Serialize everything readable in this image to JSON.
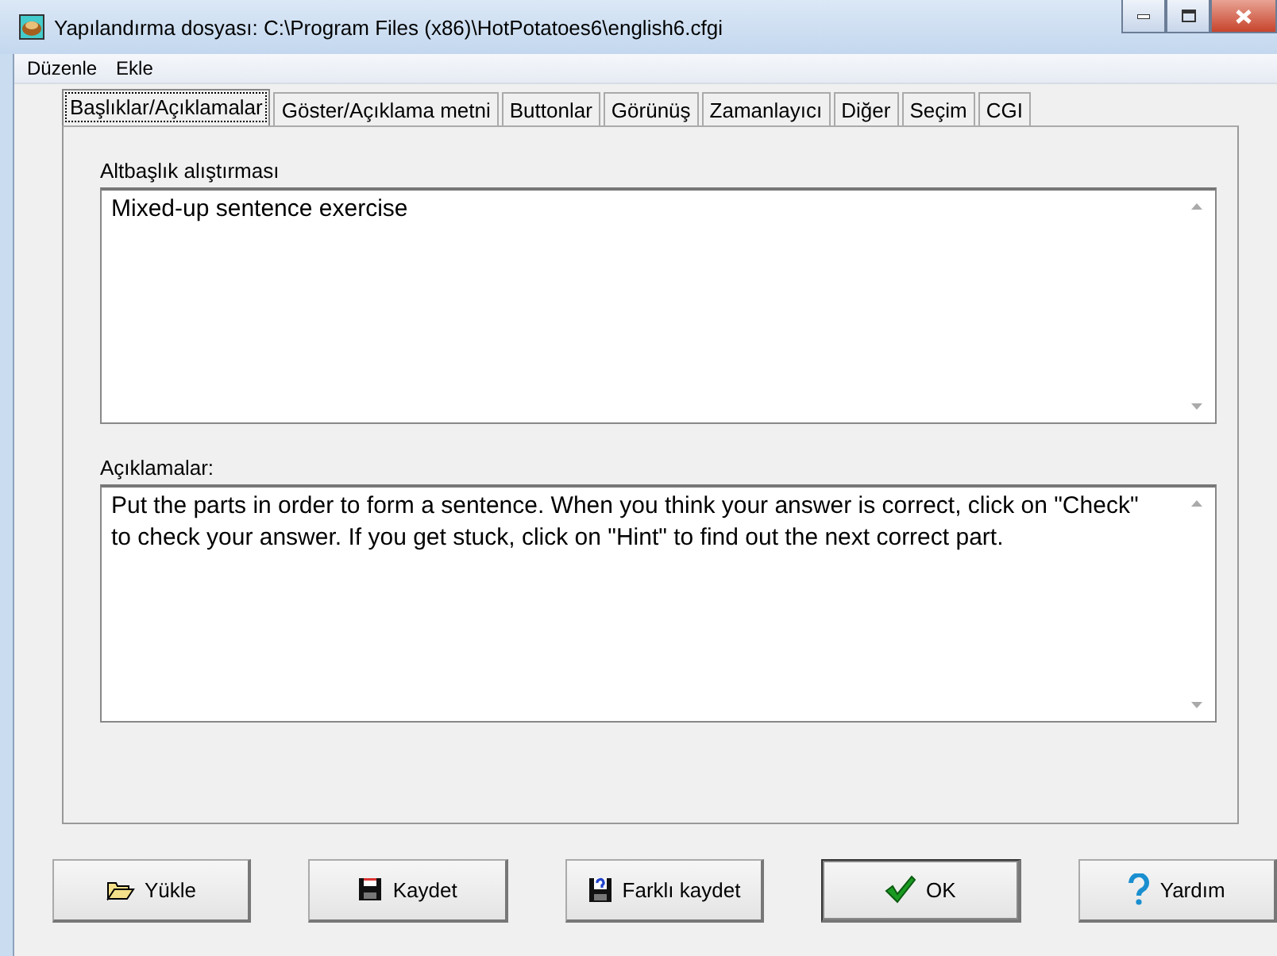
{
  "window": {
    "title": "Yapılandırma dosyası: C:\\Program Files (x86)\\HotPotatoes6\\english6.cfgi"
  },
  "menu": [
    "Düzenle",
    "Ekle"
  ],
  "tabs": [
    {
      "label": "Başlıklar/Açıklamalar",
      "selected": true
    },
    {
      "label": "Göster/Açıklama metni",
      "selected": false
    },
    {
      "label": "Buttonlar",
      "selected": false
    },
    {
      "label": "Görünüş",
      "selected": false
    },
    {
      "label": "Zamanlayıcı",
      "selected": false
    },
    {
      "label": "Diğer",
      "selected": false
    },
    {
      "label": "Seçim",
      "selected": false
    },
    {
      "label": "CGI",
      "selected": false
    }
  ],
  "fields": [
    {
      "label": "Altbaşlık alıştırması",
      "value": "Mixed-up sentence exercise"
    },
    {
      "label": "Açıklamalar:",
      "value": "Put the parts in order to form a sentence. When you think your answer is correct, click on \"Check\" to check your answer. If you get stuck, click on \"Hint\" to find out the next correct part."
    }
  ],
  "buttons": [
    {
      "label": "Yükle",
      "kind": "open",
      "default": false
    },
    {
      "label": "Kaydet",
      "kind": "save",
      "default": false
    },
    {
      "label": "Farklı kaydet",
      "kind": "saveas",
      "default": false
    },
    {
      "label": "OK",
      "kind": "ok",
      "default": true
    },
    {
      "label": "Yardım",
      "kind": "help",
      "default": false
    }
  ]
}
